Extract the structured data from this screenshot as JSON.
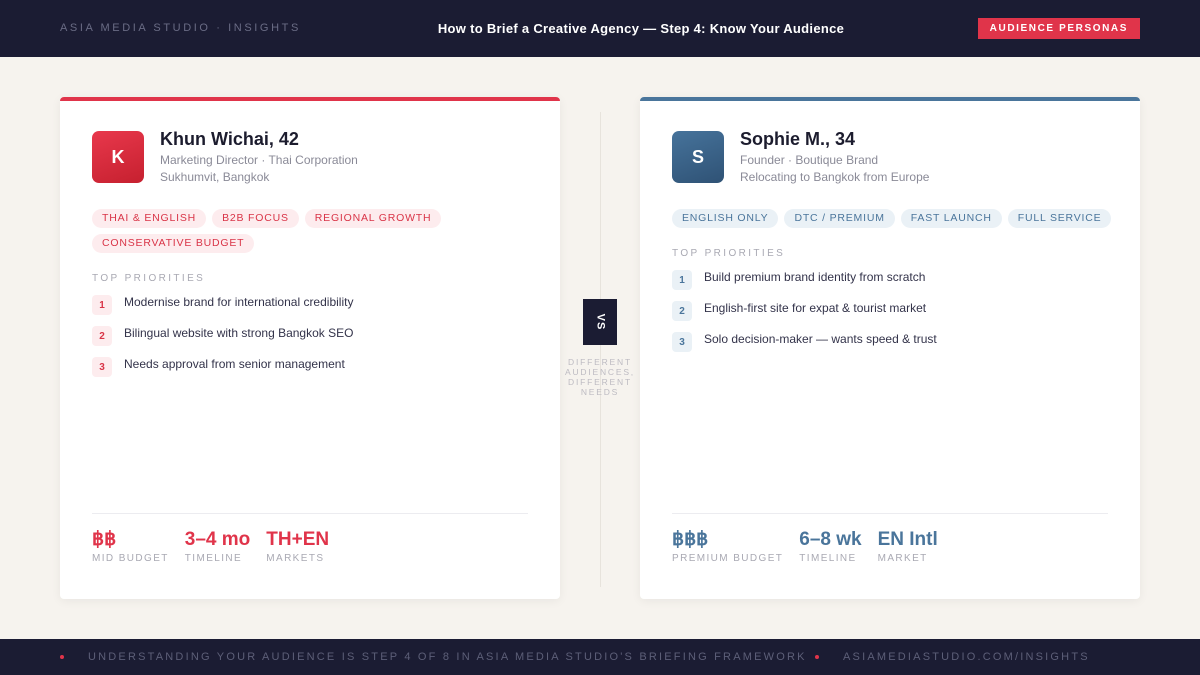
{
  "header": {
    "brand": "ASIA MEDIA STUDIO · INSIGHTS",
    "title": "How to Brief a Creative Agency — Step 4: Know Your Audience",
    "badge": "AUDIENCE PERSONAS"
  },
  "personas": [
    {
      "initial": "K",
      "name": "Khun Wichai, 42",
      "role": "Marketing Director · Thai Corporation",
      "location": "Sukhumvit, Bangkok",
      "tags": [
        "THAI & ENGLISH",
        "B2B FOCUS",
        "REGIONAL GROWTH",
        "CONSERVATIVE BUDGET"
      ],
      "priorities_heading": "TOP PRIORITIES",
      "priorities": [
        {
          "num": "1",
          "text": "Modernise brand for international credibility"
        },
        {
          "num": "2",
          "text": "Bilingual website with strong Bangkok SEO"
        },
        {
          "num": "3",
          "text": "Needs approval from senior management"
        }
      ],
      "stats": [
        {
          "value": "฿฿",
          "label": "MID BUDGET"
        },
        {
          "value": "3–4 mo",
          "label": "TIMELINE"
        },
        {
          "value": "TH+EN",
          "label": "MARKETS"
        }
      ],
      "accent_color": "#e0344a"
    },
    {
      "initial": "S",
      "name": "Sophie M., 34",
      "role": "Founder · Boutique Brand",
      "location": "Relocating to Bangkok from Europe",
      "tags": [
        "ENGLISH ONLY",
        "DTC / PREMIUM",
        "FAST LAUNCH",
        "FULL SERVICE"
      ],
      "priorities_heading": "TOP PRIORITIES",
      "priorities": [
        {
          "num": "1",
          "text": "Build premium brand identity from scratch"
        },
        {
          "num": "2",
          "text": "English-first site for expat & tourist market"
        },
        {
          "num": "3",
          "text": "Solo decision-maker — wants speed & trust"
        }
      ],
      "stats": [
        {
          "value": "฿฿฿",
          "label": "PREMIUM BUDGET"
        },
        {
          "value": "6–8 wk",
          "label": "TIMELINE"
        },
        {
          "value": "EN Intl",
          "label": "MARKET"
        }
      ],
      "accent_color": "#4a759b"
    }
  ],
  "versus": {
    "label": "VS",
    "subtitle": "DIFFERENT AUDIENCES, DIFFERENT NEEDS"
  },
  "footer": {
    "text": "UNDERSTANDING YOUR AUDIENCE IS STEP 4 OF 8 IN ASIA MEDIA STUDIO'S BRIEFING FRAMEWORK",
    "url": "ASIAMEDIASTUDIO.COM/INSIGHTS"
  }
}
